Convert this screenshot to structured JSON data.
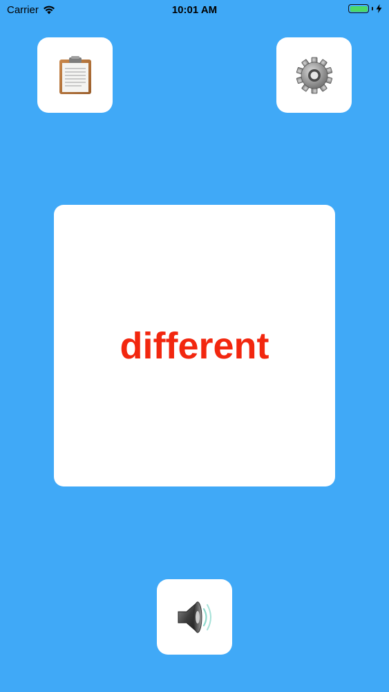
{
  "status_bar": {
    "carrier": "Carrier",
    "time": "10:01 AM"
  },
  "card": {
    "word": "different",
    "word_color": "#F2270F"
  },
  "colors": {
    "background": "#40A9F7",
    "tile": "#FFFFFF"
  },
  "icons": {
    "clipboard": "clipboard-icon",
    "settings": "gear-icon",
    "sound": "speaker-icon"
  }
}
